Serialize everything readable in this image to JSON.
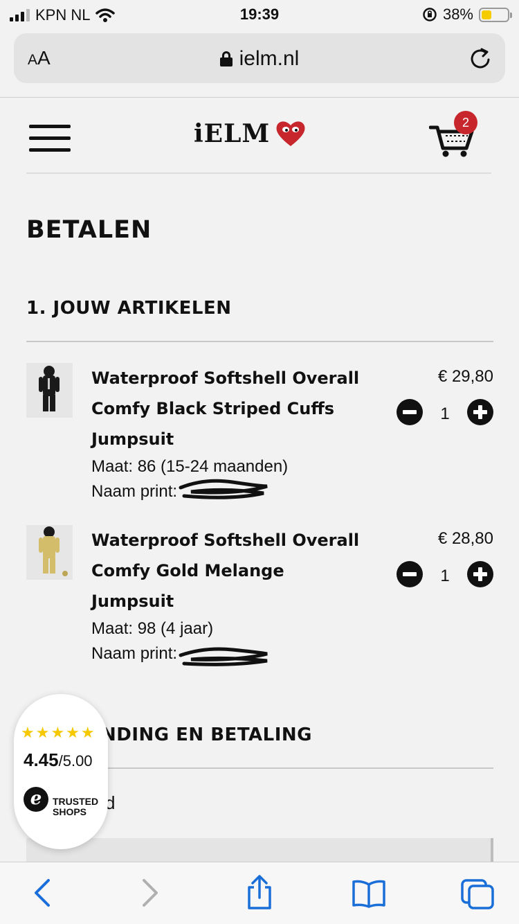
{
  "status_bar": {
    "carrier": "KPN NL",
    "time": "19:39",
    "battery_percent": "38%",
    "battery_level": 0.38
  },
  "browser": {
    "aa_label": "AA",
    "url": "ielm.nl"
  },
  "site": {
    "logo_text": "iELM",
    "cart_count": "2"
  },
  "page": {
    "title": "BETALEN",
    "section1_title": "1. JOUW ARTIKELEN"
  },
  "items": [
    {
      "name": "Waterproof Softshell Overall Comfy Black Striped Cuffs Jumpsuit",
      "size": "Maat: 86 (15-24 maanden)",
      "name_print": "Naam print: ",
      "price": "€ 29,80",
      "qty": "1"
    },
    {
      "name": "Waterproof Softshell Overall Comfy Gold Melange Jumpsuit",
      "size": "Maat: 98 (4 jaar)",
      "name_print": "Naam print: ",
      "price": "€ 28,80",
      "qty": "1"
    }
  ],
  "section2": {
    "title": "NDING EN BETALING",
    "subtitle": "d"
  },
  "trusted_shops": {
    "stars": "★★★★★",
    "score": "4.45",
    "out_of": "/5.00",
    "logo_letter": "e",
    "brand": "TRUSTED SHOPS"
  },
  "icons": [
    "back-icon",
    "forward-icon",
    "share-icon",
    "bookmarks-icon",
    "tabs-icon",
    "cart-icon",
    "menu-icon",
    "heart-logo-icon",
    "lock-icon",
    "reload-icon",
    "wifi-icon",
    "signal-icon",
    "orientation-lock-icon"
  ]
}
